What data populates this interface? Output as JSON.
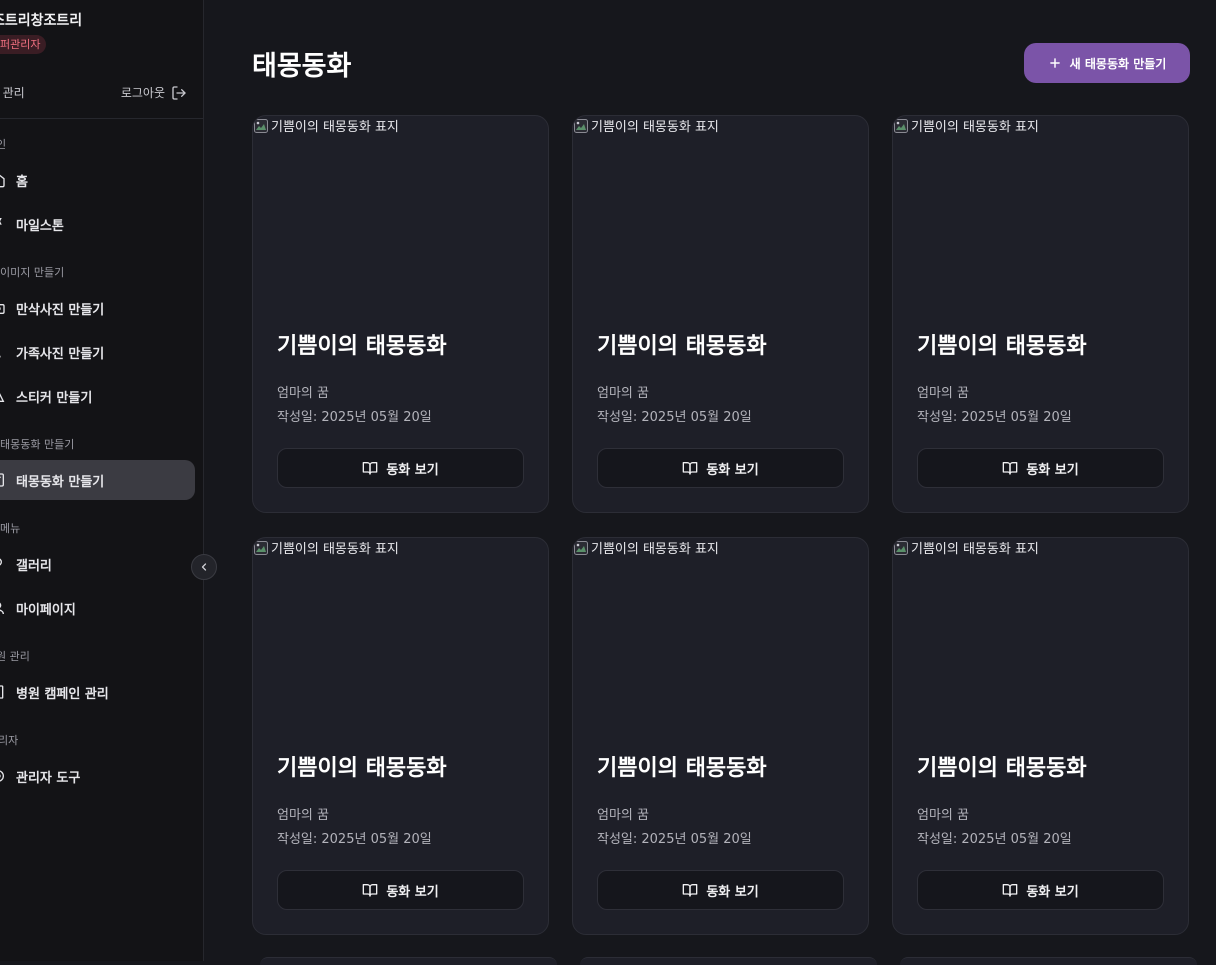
{
  "sidebar": {
    "brand": "조트리창조트리",
    "role_badge": "퍼관리자",
    "account_manage": "! 관리",
    "logout": "로그아웃",
    "sections": [
      {
        "label": "인",
        "items": [
          {
            "label": "홈",
            "icon": "home-icon"
          },
          {
            "label": "마일스톤",
            "icon": "milestone-icon"
          }
        ]
      },
      {
        "label": "이미지 만들기",
        "items": [
          {
            "label": "만삭사진 만들기",
            "icon": "camera-icon"
          },
          {
            "label": "가족사진 만들기",
            "icon": "family-icon"
          },
          {
            "label": "스티커 만들기",
            "icon": "sticker-icon"
          }
        ]
      },
      {
        "label": "태몽동화 만들기",
        "items": [
          {
            "label": "태몽동화 만들기",
            "icon": "book-icon",
            "active": true
          }
        ]
      },
      {
        "label": "메뉴",
        "items": [
          {
            "label": "갤러리",
            "icon": "gallery-icon"
          },
          {
            "label": "마이페이지",
            "icon": "user-icon"
          }
        ]
      },
      {
        "label": "원 관리",
        "items": [
          {
            "label": "병원 캠페인 관리",
            "icon": "hospital-icon"
          }
        ]
      },
      {
        "label": "리자",
        "items": [
          {
            "label": "관리자 도구",
            "icon": "settings-icon"
          }
        ]
      }
    ]
  },
  "main": {
    "title": "태몽동화",
    "new_button": "새 태몽동화 만들기",
    "cards": [
      {
        "cover_alt": "기쁨이의 태몽동화 표지",
        "title": "기쁨이의 태몽동화",
        "subtitle": "엄마의 꿈",
        "date": "작성일: 2025년 05월 20일",
        "button": "동화 보기"
      },
      {
        "cover_alt": "기쁨이의 태몽동화 표지",
        "title": "기쁨이의 태몽동화",
        "subtitle": "엄마의 꿈",
        "date": "작성일: 2025년 05월 20일",
        "button": "동화 보기"
      },
      {
        "cover_alt": "기쁨이의 태몽동화 표지",
        "title": "기쁨이의 태몽동화",
        "subtitle": "엄마의 꿈",
        "date": "작성일: 2025년 05월 20일",
        "button": "동화 보기"
      },
      {
        "cover_alt": "기쁨이의 태몽동화 표지",
        "title": "기쁨이의 태몽동화",
        "subtitle": "엄마의 꿈",
        "date": "작성일: 2025년 05월 20일",
        "button": "동화 보기"
      },
      {
        "cover_alt": "기쁨이의 태몽동화 표지",
        "title": "기쁨이의 태몽동화",
        "subtitle": "엄마의 꿈",
        "date": "작성일: 2025년 05월 20일",
        "button": "동화 보기"
      },
      {
        "cover_alt": "기쁨이의 태몽동화 표지",
        "title": "기쁨이의 태몽동화",
        "subtitle": "엄마의 꿈",
        "date": "작성일: 2025년 05월 20일",
        "button": "동화 보기"
      }
    ]
  },
  "colors": {
    "accent": "#7b54a8",
    "badge_bg": "#3a1d24",
    "badge_text": "#f07080",
    "card_bg": "#1e1f28",
    "page_bg": "#16171c",
    "sidebar_bg": "#131316"
  }
}
